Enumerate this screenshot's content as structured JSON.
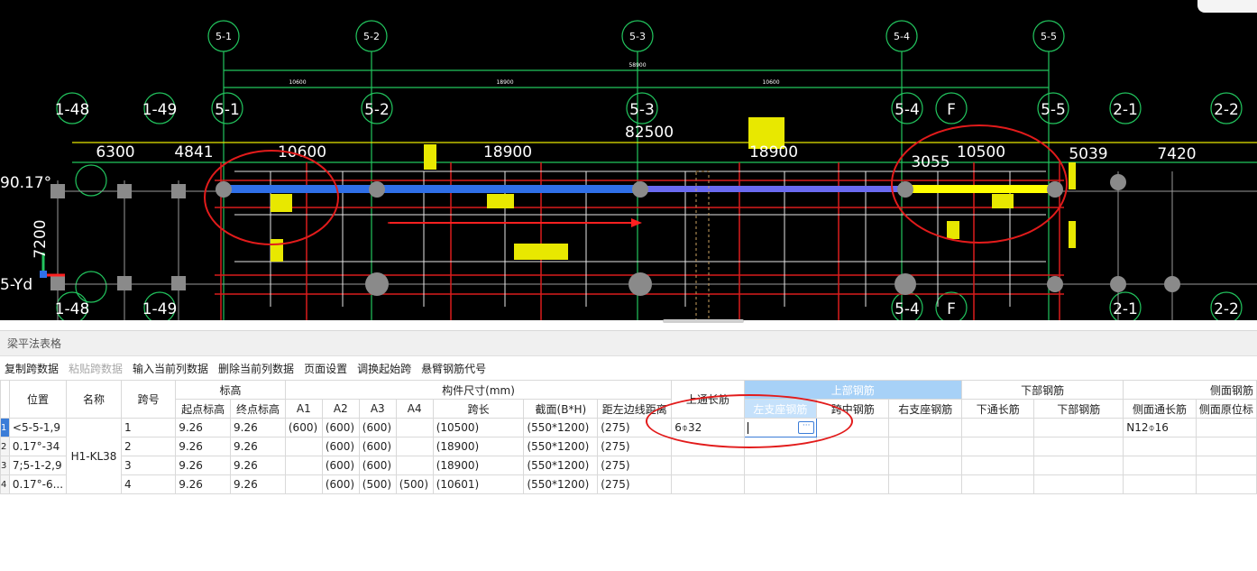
{
  "cad": {
    "axis_top": [
      "5-1",
      "5-2",
      "5-3",
      "5-4",
      "5-5"
    ],
    "axis_mid": [
      "1-48",
      "1-49",
      "5-1",
      "5-2",
      "5-3",
      "5-4",
      "F",
      "5-5",
      "2-1",
      "2-2"
    ],
    "axis_bottom": [
      "1-48",
      "1-49",
      "5-4",
      "F",
      "2-1",
      "2-2"
    ],
    "dims_top": [
      "10600",
      "18900",
      "10600",
      "58900"
    ],
    "dims_mid": [
      "6300",
      "4841",
      "10600",
      "18900",
      "82500",
      "18900",
      "3055",
      "10500",
      "5039",
      "7420"
    ],
    "left_labels": [
      "90.17°",
      "7200",
      "5-Yd"
    ]
  },
  "panel": {
    "title": "梁平法表格",
    "toolbar": [
      "复制跨数据",
      "粘贴跨数据",
      "输入当前列数据",
      "删除当前列数据",
      "页面设置",
      "调换起始跨",
      "悬臂钢筋代号"
    ]
  },
  "table": {
    "h1": {
      "position": "位置",
      "name": "名称",
      "span": "跨号",
      "elev": "标高",
      "size": "构件尺寸(mm)",
      "top_rebar": "上部钢筋",
      "bottom_rebar": "下部钢筋",
      "side_rebar": "侧面钢筋"
    },
    "h2": {
      "start_elev": "起点标高",
      "end_elev": "终点标高",
      "a1": "A1",
      "a2": "A2",
      "a3": "A3",
      "a4": "A4",
      "span_len": "跨长",
      "section": "截面(B*H)",
      "edge_dist": "距左边线距离",
      "top_through": "上通长筋",
      "left_support": "左支座钢筋",
      "mid_span": "跨中钢筋",
      "right_support": "右支座钢筋",
      "bot_through": "下通长筋",
      "bot_rebar": "下部钢筋",
      "side_through": "侧面通长筋",
      "side_original": "侧面原位标"
    },
    "positions": [
      "<5-5-1,9",
      "0.17°-34",
      "7;5-1-2,9",
      "0.17°-6..."
    ],
    "name_value": "H1-KL38",
    "rows": [
      {
        "num": "1",
        "span": "1",
        "start": "9.26",
        "end": "9.26",
        "a1": "(600)",
        "a2": "(600)",
        "a3": "(600)",
        "a4": "",
        "len": "(10500)",
        "sec": "(550*1200)",
        "dist": "(275)",
        "top": "6⌽32",
        "side": "N12⌽16"
      },
      {
        "num": "2",
        "span": "2",
        "start": "9.26",
        "end": "9.26",
        "a1": "",
        "a2": "(600)",
        "a3": "(600)",
        "a4": "",
        "len": "(18900)",
        "sec": "(550*1200)",
        "dist": "(275)",
        "top": "",
        "side": ""
      },
      {
        "num": "3",
        "span": "3",
        "start": "9.26",
        "end": "9.26",
        "a1": "",
        "a2": "(600)",
        "a3": "(600)",
        "a4": "",
        "len": "(18900)",
        "sec": "(550*1200)",
        "dist": "(275)",
        "top": "",
        "side": ""
      },
      {
        "num": "4",
        "span": "4",
        "start": "9.26",
        "end": "9.26",
        "a1": "",
        "a2": "(600)",
        "a3": "(500)",
        "a4": "(500)",
        "len": "(10601)",
        "sec": "(550*1200)",
        "dist": "(275)",
        "top": "",
        "side": ""
      }
    ],
    "ellipsis": "···"
  },
  "colors": {
    "selected_header": "#a7d1f7",
    "annotation": "#e21b1b",
    "beam_blue": "#2f6fe8",
    "beam_yellow": "#ffff00"
  }
}
